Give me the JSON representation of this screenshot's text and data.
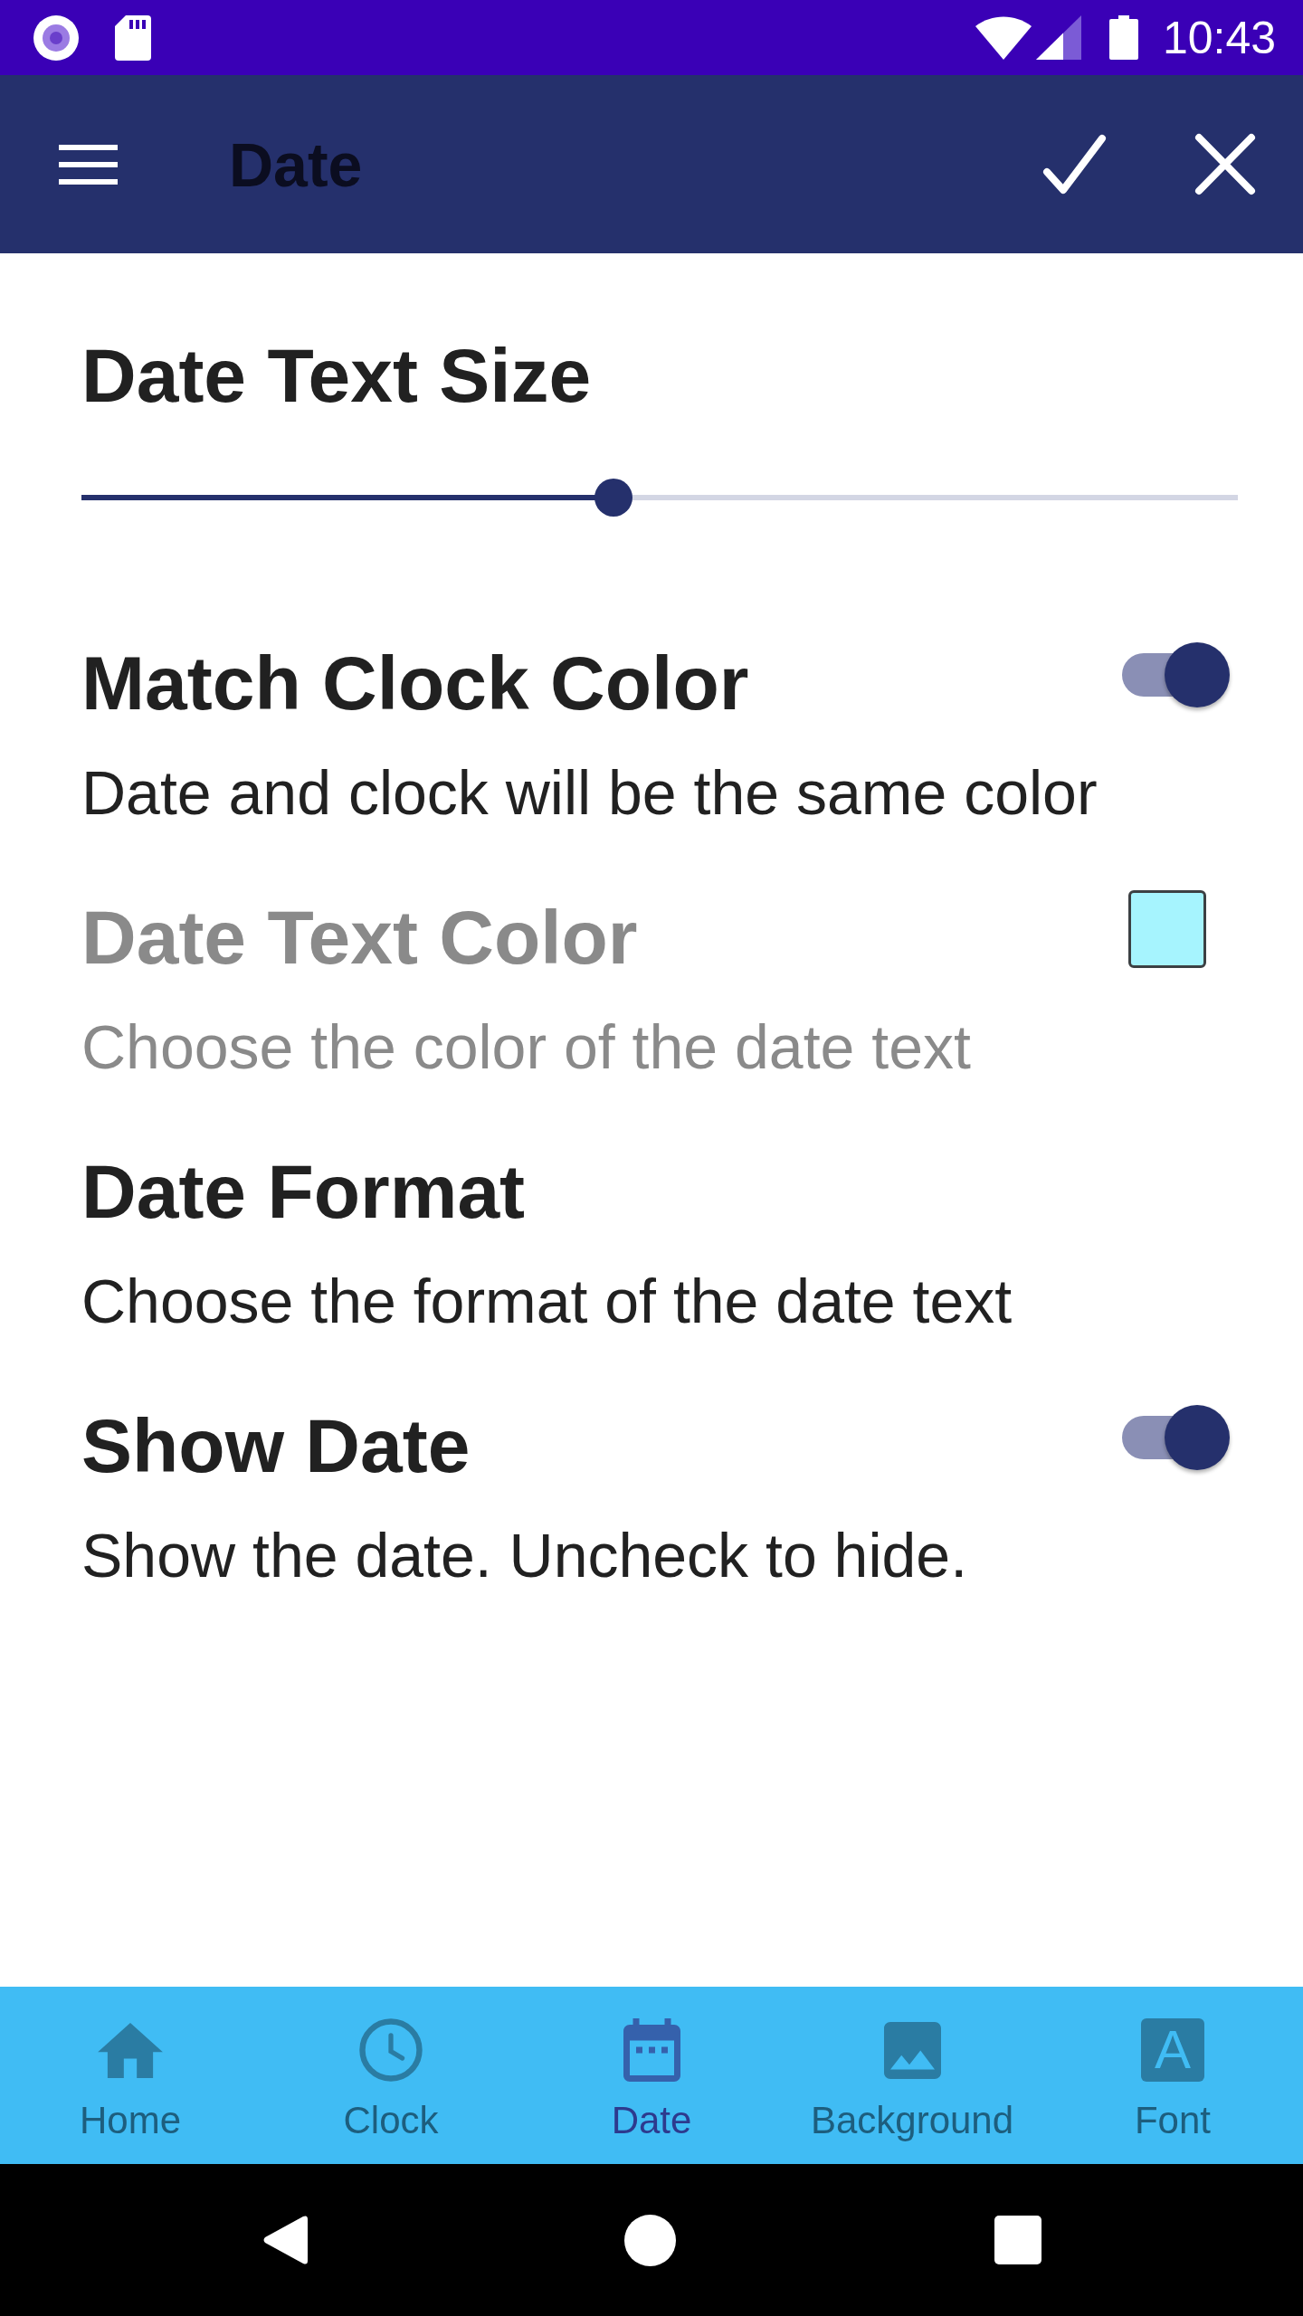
{
  "status_bar": {
    "time": "10:43"
  },
  "app_bar": {
    "title": "Date"
  },
  "settings": [
    {
      "kind": "slider",
      "title": "Date Text Size",
      "level": 0.46,
      "disabled": false
    },
    {
      "kind": "switch",
      "title": "Match Clock Color",
      "summary": "Date and clock will be the same color",
      "on": true,
      "disabled": false
    },
    {
      "kind": "color",
      "title": "Date Text Color",
      "summary": "Choose the color of the date text",
      "color": "#a6f4fe",
      "disabled": true
    },
    {
      "kind": "text",
      "title": "Date Format",
      "summary": "Choose the format of the date text",
      "disabled": false
    },
    {
      "kind": "switch",
      "title": "Show Date",
      "summary": "Show the date. Uncheck to hide.",
      "on": true,
      "disabled": false
    }
  ],
  "bottom_nav": [
    {
      "label": "Home",
      "selected": false
    },
    {
      "label": "Clock",
      "selected": false
    },
    {
      "label": "Date",
      "selected": true
    },
    {
      "label": "Background",
      "selected": false
    },
    {
      "label": "Font",
      "selected": false,
      "icon_text": "A"
    }
  ]
}
